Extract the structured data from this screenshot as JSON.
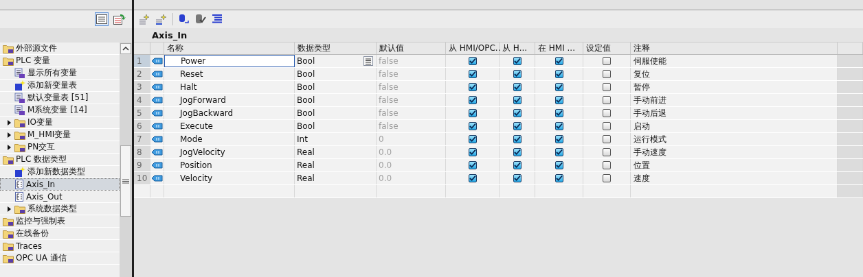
{
  "tree": [
    {
      "label": "外部源文件",
      "kind": "folder",
      "selected": false
    },
    {
      "label": "PLC 变量",
      "kind": "folder",
      "selected": false,
      "children": [
        {
          "label": "显示所有变量",
          "kind": "list",
          "selected": false
        },
        {
          "label": "添加新变量表",
          "kind": "add",
          "selected": false
        },
        {
          "label": "默认变量表 [51]",
          "kind": "list",
          "selected": false
        },
        {
          "label": "M系统变量 [14]",
          "kind": "list",
          "selected": false
        },
        {
          "label": "IO变量",
          "kind": "folder",
          "selected": false,
          "expanded": false
        },
        {
          "label": "M_HMI变量",
          "kind": "folder",
          "selected": false,
          "expanded": false
        },
        {
          "label": "PN交互",
          "kind": "folder",
          "selected": false,
          "expanded": false
        }
      ]
    },
    {
      "label": "PLC 数据类型",
      "kind": "folder",
      "selected": false,
      "children": [
        {
          "label": "添加新数据类型",
          "kind": "add",
          "selected": false
        },
        {
          "label": "Axis_In",
          "kind": "datatype",
          "selected": true
        },
        {
          "label": "Axis_Out",
          "kind": "datatype",
          "selected": false
        },
        {
          "label": "系统数据类型",
          "kind": "folder",
          "selected": false,
          "expanded": false
        }
      ]
    },
    {
      "label": "监控与强制表",
      "kind": "folder",
      "selected": false
    },
    {
      "label": "在线备份",
      "kind": "folder",
      "selected": false
    },
    {
      "label": "Traces",
      "kind": "folder",
      "selected": false
    },
    {
      "label": "OPC UA 通信",
      "kind": "folder",
      "selected": false
    }
  ],
  "editor": {
    "title": "Axis_In",
    "columns": [
      "名称",
      "数据类型",
      "默认值",
      "从 HMI/OPC..",
      "从 H...",
      "在 HMI ...",
      "设定值",
      "注释"
    ],
    "rows": [
      {
        "num": "1",
        "name": "Power",
        "type": "Bool",
        "default": "false",
        "flags": [
          true,
          true,
          true,
          false
        ],
        "comment": "伺服使能",
        "selected": true
      },
      {
        "num": "2",
        "name": "Reset",
        "type": "Bool",
        "default": "false",
        "flags": [
          true,
          true,
          true,
          false
        ],
        "comment": "复位",
        "selected": false
      },
      {
        "num": "3",
        "name": "Halt",
        "type": "Bool",
        "default": "false",
        "flags": [
          true,
          true,
          true,
          false
        ],
        "comment": "暂停",
        "selected": false
      },
      {
        "num": "4",
        "name": "JogForward",
        "type": "Bool",
        "default": "false",
        "flags": [
          true,
          true,
          true,
          false
        ],
        "comment": "手动前进",
        "selected": false
      },
      {
        "num": "5",
        "name": "JogBackward",
        "type": "Bool",
        "default": "false",
        "flags": [
          true,
          true,
          true,
          false
        ],
        "comment": "手动后退",
        "selected": false
      },
      {
        "num": "6",
        "name": "Execute",
        "type": "Bool",
        "default": "false",
        "flags": [
          true,
          true,
          true,
          false
        ],
        "comment": "启动",
        "selected": false
      },
      {
        "num": "7",
        "name": "Mode",
        "type": "Int",
        "default": "0",
        "flags": [
          true,
          true,
          true,
          false
        ],
        "comment": "运行模式",
        "selected": false
      },
      {
        "num": "8",
        "name": "JogVelocity",
        "type": "Real",
        "default": "0.0",
        "flags": [
          true,
          true,
          true,
          false
        ],
        "comment": "手动速度",
        "selected": false
      },
      {
        "num": "9",
        "name": "Position",
        "type": "Real",
        "default": "0.0",
        "flags": [
          true,
          true,
          true,
          false
        ],
        "comment": "位置",
        "selected": false
      },
      {
        "num": "10",
        "name": "Velocity",
        "type": "Real",
        "default": "0.0",
        "flags": [
          true,
          true,
          true,
          false
        ],
        "comment": "速度",
        "selected": false
      }
    ]
  }
}
